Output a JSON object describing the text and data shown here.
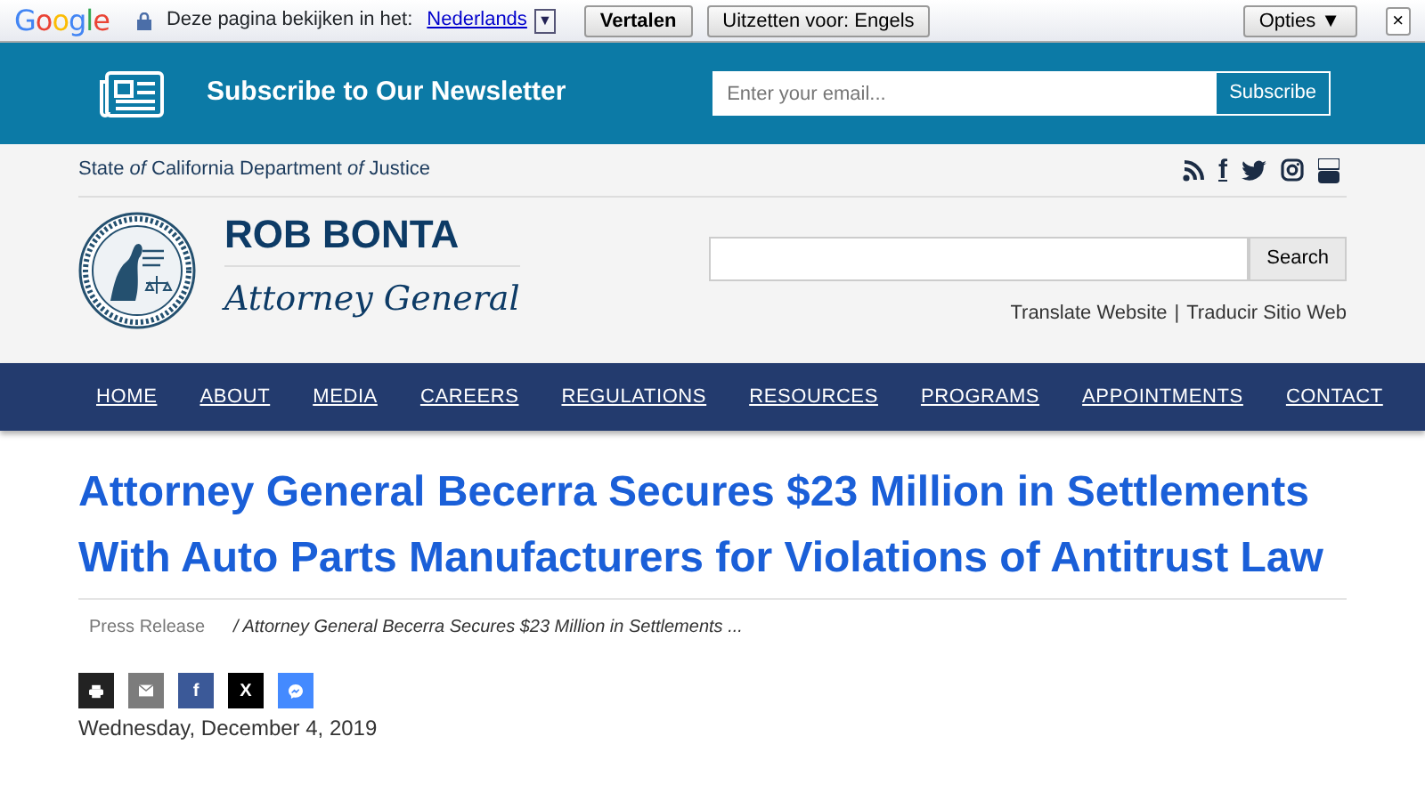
{
  "translate_bar": {
    "logo": "Google",
    "prompt": "Deze pagina bekijken in het:",
    "language": "Nederlands",
    "dropdown": "▼",
    "translate_button": "Vertalen",
    "disable_button": "Uitzetten voor: Engels",
    "options_button": "Opties ▼",
    "close": "×"
  },
  "newsletter": {
    "title": "Subscribe to Our Newsletter",
    "placeholder": "Enter your email...",
    "button": "Subscribe"
  },
  "header": {
    "department": "State *of* California Department *of* Justice",
    "social": [
      {
        "kind": "rss"
      },
      {
        "kind": "facebook",
        "glyph": "f"
      },
      {
        "kind": "twitter"
      },
      {
        "kind": "instagram"
      },
      {
        "kind": "youtube"
      }
    ],
    "name": "ROB BONTA",
    "role": "Attorney General",
    "search_button": "Search",
    "translate_links": [
      "Translate Website",
      "Traducir Sitio Web"
    ],
    "separator": "|"
  },
  "nav": [
    "HOME",
    "ABOUT",
    "MEDIA",
    "CAREERS",
    "REGULATIONS",
    "RESOURCES",
    "PROGRAMS",
    "APPOINTMENTS",
    "CONTACT"
  ],
  "article": {
    "title": "Attorney General Becerra Secures $23 Million in Settlements With Auto Parts Manufacturers for Violations of Antitrust Law",
    "breadcrumb": [
      "Press Release",
      "Attorney General Becerra Secures $23 Million in Settlements ..."
    ],
    "breadcrumb_separator": "/",
    "share": [
      {
        "kind": "print"
      },
      {
        "kind": "email"
      },
      {
        "kind": "facebook",
        "glyph": "f"
      },
      {
        "kind": "x",
        "glyph": "X"
      },
      {
        "kind": "messenger"
      }
    ],
    "date": "Wednesday, December 4, 2019"
  }
}
